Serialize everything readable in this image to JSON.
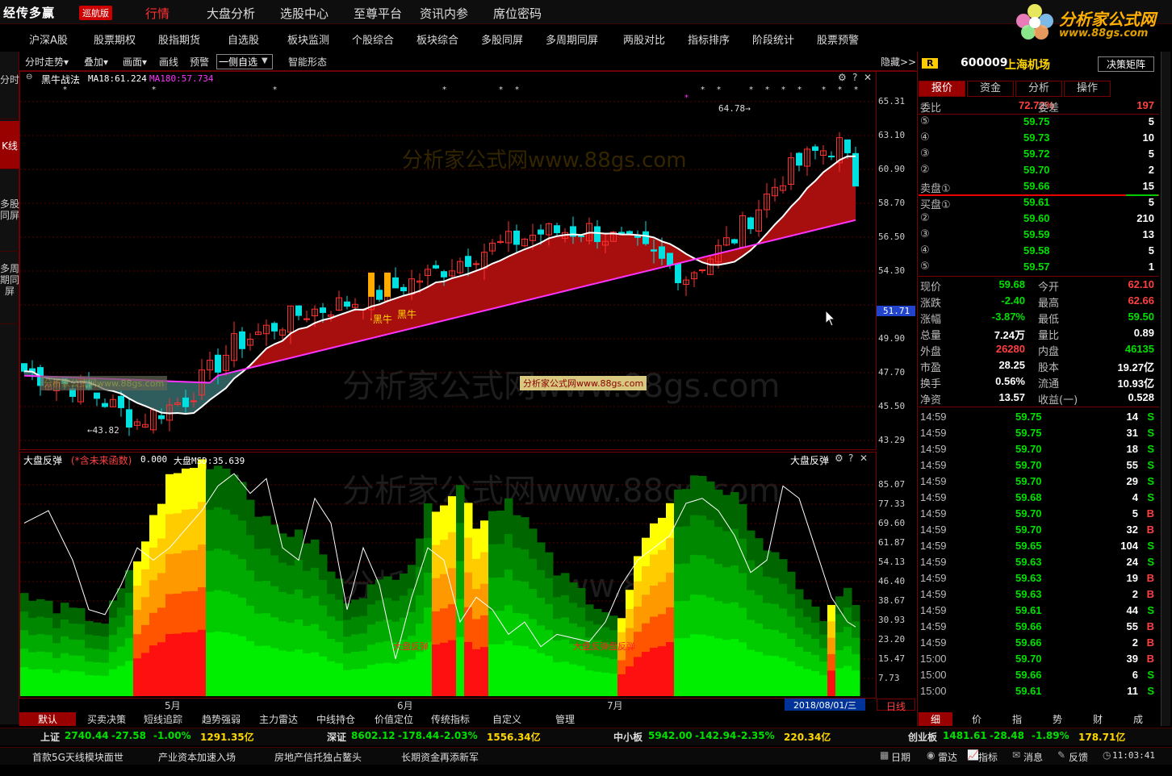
{
  "app": {
    "logo": "经传多赢",
    "logo_tag": "巡航版",
    "brand_name": "分析家公式网",
    "brand_url": "www.88gs.com"
  },
  "topmenu": [
    "行情",
    "大盘分析",
    "选股中心",
    "至尊平台",
    "资讯内参",
    "席位密码"
  ],
  "menu2": [
    "沪深A股",
    "股票期权",
    "股指期货",
    "自选股",
    "板块监测",
    "个股综合",
    "板块综合",
    "多股同屏",
    "多周期同屏",
    "两股对比",
    "指标排序",
    "阶段统计",
    "股票预警"
  ],
  "lefttabs": [
    "分时",
    "K线",
    "多股同屏",
    "多周期同屏"
  ],
  "charttool": {
    "items": [
      "分时走势▾",
      "叠加▾",
      "画面▾",
      "画线",
      "预警"
    ],
    "dropdown": "一侧自选",
    "smart": "智能形态",
    "hide": "隐藏>>"
  },
  "main_indicator": {
    "name": "黑牛战法",
    "ma18": "MA18:61.224",
    "ma180": "MA180:57.734",
    "label1": "·黑牛",
    "label2": "黑牛",
    "max_label": "64.78→",
    "min_label": "←43.82"
  },
  "ind2": {
    "name": "大盘反弹",
    "note": "(*含未来函数)",
    "val": "0.000",
    "msd": "大盘MSD:35.639",
    "title_r": "大盘反弹",
    "label1": "大盘反弹",
    "label2": "大盘反弹盘反弹"
  },
  "watermarks": [
    "分析家公式网www.88gs.com",
    "分析家公式网www.88gs.com",
    "分析家公式网www.88gs.com",
    "分析家公式网www.88gs.com"
  ],
  "wm_small": "分析家公式网www.88gs.com",
  "yaxis1": [
    "65.31",
    "63.10",
    "60.90",
    "58.70",
    "56.50",
    "54.30",
    "51.71",
    "49.90",
    "47.70",
    "45.50",
    "43.29"
  ],
  "yaxis1_current": "51.71",
  "yaxis2": [
    "85.07",
    "77.33",
    "69.60",
    "61.87",
    "54.13",
    "46.40",
    "38.67",
    "30.93",
    "23.20",
    "15.47",
    "7.73"
  ],
  "xaxis": [
    "5月",
    "6月",
    "7月"
  ],
  "datebox": "2018/08/01/三",
  "riline": "日线",
  "bottomtabs": [
    "默认",
    "买卖决策",
    "短线追踪",
    "趋势强弱",
    "主力雷达",
    "中线持仓",
    "价值定位",
    "传统指标",
    "自定义",
    "管理"
  ],
  "rtabs_bottom": [
    "细",
    "价",
    "指",
    "势",
    "财",
    "成"
  ],
  "stock": {
    "code": "600009",
    "name": "上海机场",
    "btn": "决策矩阵",
    "r_badge": "R"
  },
  "rtabs": [
    "报价",
    "资金",
    "分析",
    "操作"
  ],
  "weibi": {
    "label": "委比",
    "value": "72.72%",
    "label2": "委差",
    "value2": "197"
  },
  "asks": [
    {
      "n": "⑤",
      "p": "59.75",
      "v": "5"
    },
    {
      "n": "④",
      "p": "59.73",
      "v": "10"
    },
    {
      "n": "③",
      "p": "59.72",
      "v": "5"
    },
    {
      "n": "②",
      "p": "59.70",
      "v": "2"
    },
    {
      "n": "卖盘①",
      "p": "59.66",
      "v": "15"
    }
  ],
  "bids": [
    {
      "n": "买盘①",
      "p": "59.61",
      "v": "5"
    },
    {
      "n": "②",
      "p": "59.60",
      "v": "210"
    },
    {
      "n": "③",
      "p": "59.59",
      "v": "13"
    },
    {
      "n": "④",
      "p": "59.58",
      "v": "5"
    },
    {
      "n": "⑤",
      "p": "59.57",
      "v": "1"
    }
  ],
  "quote": [
    {
      "l1": "现价",
      "v1": "59.68",
      "c1": "green",
      "l2": "今开",
      "v2": "62.10",
      "c2": "red"
    },
    {
      "l1": "涨跌",
      "v1": "-2.40",
      "c1": "green",
      "l2": "最高",
      "v2": "62.66",
      "c2": "red"
    },
    {
      "l1": "涨幅",
      "v1": "-3.87%",
      "c1": "green",
      "l2": "最低",
      "v2": "59.50",
      "c2": "green"
    },
    {
      "l1": "总量",
      "v1": "7.24万",
      "c1": "white",
      "l2": "量比",
      "v2": "0.89",
      "c2": "white"
    },
    {
      "l1": "外盘",
      "v1": "26280",
      "c1": "red",
      "l2": "内盘",
      "v2": "46135",
      "c2": "green"
    },
    {
      "l1": "市盈",
      "v1": "28.25",
      "c1": "white",
      "l2": "股本",
      "v2": "19.27亿",
      "c2": "white"
    },
    {
      "l1": "换手",
      "v1": "0.56%",
      "c1": "white",
      "l2": "流通",
      "v2": "10.93亿",
      "c2": "white"
    },
    {
      "l1": "净资",
      "v1": "13.57",
      "c1": "white",
      "l2": "收益(一)",
      "v2": "0.528",
      "c2": "white"
    }
  ],
  "ticks": [
    {
      "t": "14:59",
      "p": "59.75",
      "v": "14",
      "d": "S"
    },
    {
      "t": "14:59",
      "p": "59.75",
      "v": "31",
      "d": "S"
    },
    {
      "t": "14:59",
      "p": "59.70",
      "v": "18",
      "d": "S"
    },
    {
      "t": "14:59",
      "p": "59.70",
      "v": "55",
      "d": "S"
    },
    {
      "t": "14:59",
      "p": "59.70",
      "v": "29",
      "d": "S"
    },
    {
      "t": "14:59",
      "p": "59.68",
      "v": "4",
      "d": "S"
    },
    {
      "t": "14:59",
      "p": "59.70",
      "v": "5",
      "d": "B"
    },
    {
      "t": "14:59",
      "p": "59.70",
      "v": "32",
      "d": "B"
    },
    {
      "t": "14:59",
      "p": "59.65",
      "v": "104",
      "d": "S"
    },
    {
      "t": "14:59",
      "p": "59.63",
      "v": "24",
      "d": "S"
    },
    {
      "t": "14:59",
      "p": "59.63",
      "v": "19",
      "d": "B"
    },
    {
      "t": "14:59",
      "p": "59.63",
      "v": "2",
      "d": "B"
    },
    {
      "t": "14:59",
      "p": "59.61",
      "v": "44",
      "d": "S"
    },
    {
      "t": "14:59",
      "p": "59.66",
      "v": "55",
      "d": "B"
    },
    {
      "t": "14:59",
      "p": "59.66",
      "v": "2",
      "d": "B"
    },
    {
      "t": "15:00",
      "p": "59.70",
      "v": "39",
      "d": "B"
    },
    {
      "t": "15:00",
      "p": "59.66",
      "v": "6",
      "d": "S"
    },
    {
      "t": "15:00",
      "p": "59.61",
      "v": "11",
      "d": "S"
    }
  ],
  "status": [
    {
      "name": "上证",
      "v": "2740.44",
      "chg": "-27.58",
      "pct": "-1.00%",
      "amt": "1291.35亿"
    },
    {
      "name": "深证",
      "v": "8602.12",
      "chg": "-178.44",
      "pct": "-2.03%",
      "amt": "1556.34亿"
    },
    {
      "name": "中小板",
      "v": "5942.00",
      "chg": "-142.94",
      "pct": "-2.35%",
      "amt": "220.34亿"
    },
    {
      "name": "创业板",
      "v": "1481.61",
      "chg": "-28.48",
      "pct": "-1.89%",
      "amt": "178.71亿"
    }
  ],
  "news": [
    "首款5G天线模块面世",
    "产业资本加速入场",
    "房地产信托独占鳌头",
    "长期资金再添新军"
  ],
  "tray": {
    "items": [
      "日期",
      "雷达",
      "指标",
      "消息",
      "反馈"
    ],
    "time": "11:03:41"
  }
}
